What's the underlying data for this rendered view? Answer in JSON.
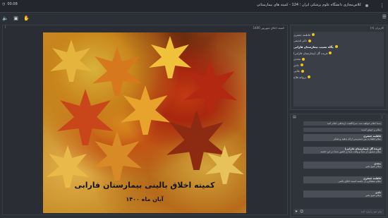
{
  "topbar": {
    "time": "00:08",
    "title": "کلاس‌مجازی دانشگاه علوم پزشکی ایران ؛ 124 - کمیته های بیمارستانی"
  },
  "presentation": {
    "name": "کمیته اخلاق شهریور 1400",
    "slide_title": "کمیته اخلاق بالینی بیمارستان فارابی",
    "slide_date": "آبان ماه ۱۴۰۰"
  },
  "users_panel": {
    "header": "کاربران (۹)",
    "users": [
      {
        "name": "فاطمه جعفری",
        "bold": false
      },
      {
        "name": "دکتر قدیمی",
        "bold": false
      },
      {
        "name": "پگاه نصیب بیمارستان فارابی",
        "bold": true
      },
      {
        "name": "فریده گل (بیمارستان فارابی)",
        "bold": false
      },
      {
        "name": "مجدی",
        "bold": false
      },
      {
        "name": "دادی",
        "bold": false
      },
      {
        "name": "علایی",
        "bold": false
      },
      {
        "name": "پروانه فلاح",
        "bold": false
      }
    ]
  },
  "chat": {
    "header": "گفتگو",
    "messages": [
      {
        "author": "",
        "text": "شما اعلام خواهید شد، سرانگشت ارتباطی اعلام کنید"
      },
      {
        "author": "",
        "text": "سلام و خوش آمدید"
      },
      {
        "author": "فاطمه جعفری",
        "text": "سلام لطفا به من دسترسی ارائه بدهید و تشکر"
      },
      {
        "author": "فریده گل (بیمارستان فارابی)",
        "text": "سلام ممنون از شما و وقت شما و حضور شما در این جلسه"
      },
      {
        "author": "مجدی",
        "text": "سلام صبح بخیر"
      },
      {
        "author": "فاطمه جعفری",
        "text": "سلام متشکرم از جلسه کمیته اخلاق بالینی"
      },
      {
        "author": "دادی",
        "text": "سلام صبح بخیر"
      }
    ],
    "input_placeholder": "پیام خود را وارد کنید"
  }
}
